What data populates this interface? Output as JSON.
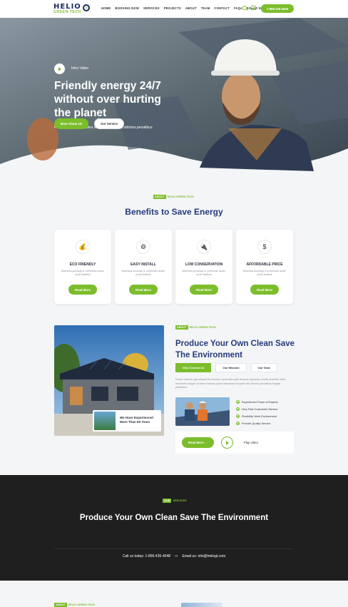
{
  "header": {
    "logo_main": "HELIO",
    "logo_sub": "GREEN TECH",
    "nav": [
      "HOME",
      "BOOKING NOW",
      "SERVICES",
      "PROJECTS",
      "ABOUT",
      "TEAM",
      "CONTACT",
      "FAQs",
      "SOLAR NEWS"
    ],
    "phone_button": "1-866-435-4648"
  },
  "hero": {
    "intro_label": "Intro Video",
    "title": "Friendly energy 24/7 without over hurting the planet",
    "subtitle": "Proin a faucibus sodales sollicitudin fringilla ultricies penatibus",
    "primary_button": "More About Us",
    "secondary_button": "Our Service"
  },
  "benefits": {
    "tag_pill": "ABOUT",
    "tag_text": "HELIO GREEN TECH",
    "title": "Benefits to Save Energy",
    "cards": [
      {
        "icon": "hand-coin-icon",
        "title": "ECO FRIENDLY",
        "text": "Ubertcas accusay in commodo quam proin facilisis",
        "button": "Read More"
      },
      {
        "icon": "gear-icon",
        "title": "EASY INSTALL",
        "text": "Ubertcas accusay in commodo quam proin facilisis",
        "button": "Read More"
      },
      {
        "icon": "plug-icon",
        "title": "LOW CONSERVATION",
        "text": "Ubertcas accusay in commodo quam proin facilisis",
        "button": "Read More"
      },
      {
        "icon": "money-bag-icon",
        "title": "AFFORDABLE PRICE",
        "text": "Ubertcas accusay in commodo quam proin facilisis",
        "button": "Read More"
      }
    ]
  },
  "about": {
    "tag_pill": "ABOUT",
    "tag_text": "HELIO GREEN TECH",
    "title": "Produce Your Own Clean Save The Environment",
    "experience": "We Have Experienced More Than 60 Years",
    "tabs": [
      "Why Choose Us",
      "Our Mission",
      "Our Goal"
    ],
    "paragraph": "Donec mauris eget aliquet fermentum venenatis iacili tempus dignissim mollis pharetra vitae hendrerit congue at tmar rhoncus proin bibendum torquent life ultrices penatibus feugiat phasellus.",
    "checklist": [
      "Experienced Team of Experts",
      "Very Fast Customers Service",
      "Flexibility Work Environment",
      "Provide Quality Service"
    ],
    "button": "Read More",
    "play_text": "Play Video"
  },
  "services": {
    "tag_pill": "OUR",
    "tag_text": "SERVICES",
    "title": "Produce Your Own Clean Save The Environment",
    "contact_call": "Call us today: 1-866-435-4648",
    "contact_or": "or",
    "contact_email": "Email us: info@heliogt.com"
  },
  "bottom": {
    "tag_pill": "ABOUT",
    "tag_text": "HELIO GREEN TECH"
  },
  "colors": {
    "accent": "#7bbd2b",
    "heading": "#253a7a",
    "dark_bg": "#1f1f1f"
  }
}
